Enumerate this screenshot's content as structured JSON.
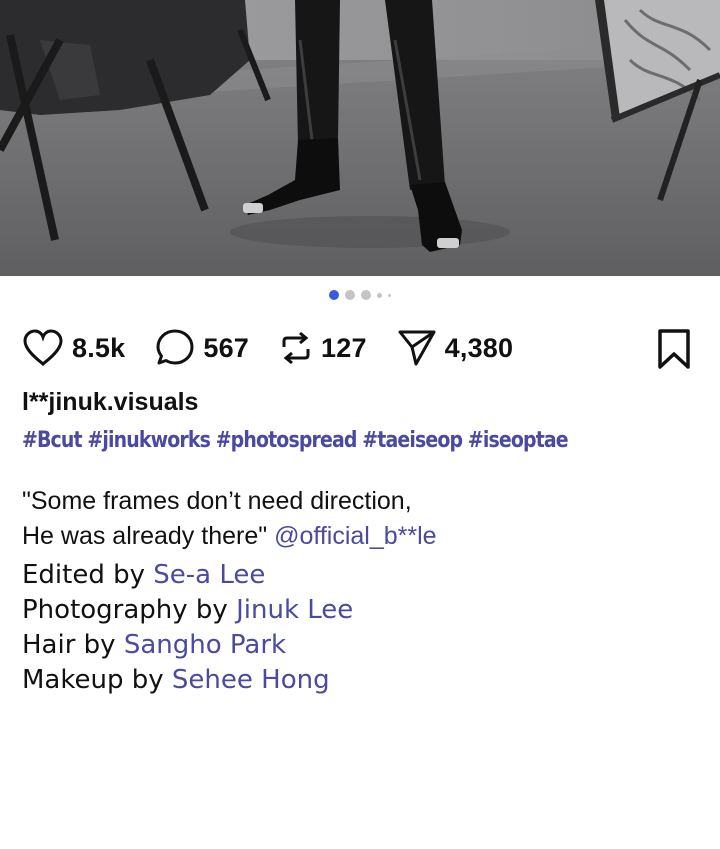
{
  "post": {
    "photo_alt": "photo-carousel",
    "carousel": {
      "count": 5,
      "active": 0
    },
    "actions": {
      "likes": "8.5k",
      "comments": "567",
      "reposts": "127",
      "shares": "4,380"
    },
    "username": "l**jinuk.visuals",
    "hashtags": "#Bcut #jinukworks #photospread #taeiseop #iseoptae",
    "caption_line1": "\"Some frames don’t need direction,",
    "caption_line2": "He was already there\"",
    "mention": "@official_b**le",
    "credits": [
      {
        "role": "Edited by",
        "name": "Se-a Lee"
      },
      {
        "role": "Photography by",
        "name": "Jinuk Lee"
      },
      {
        "role": "Hair by",
        "name": "Sangho Park"
      },
      {
        "role": "Makeup by",
        "name": "Sehee Hong"
      }
    ]
  },
  "colors": {
    "link": "#4a4aa0",
    "active_dot": "#3d5bd9",
    "inactive_dot": "#c4c4c4"
  },
  "icons": [
    "heart-icon",
    "comment-icon",
    "repost-icon",
    "send-icon",
    "bookmark-icon"
  ]
}
